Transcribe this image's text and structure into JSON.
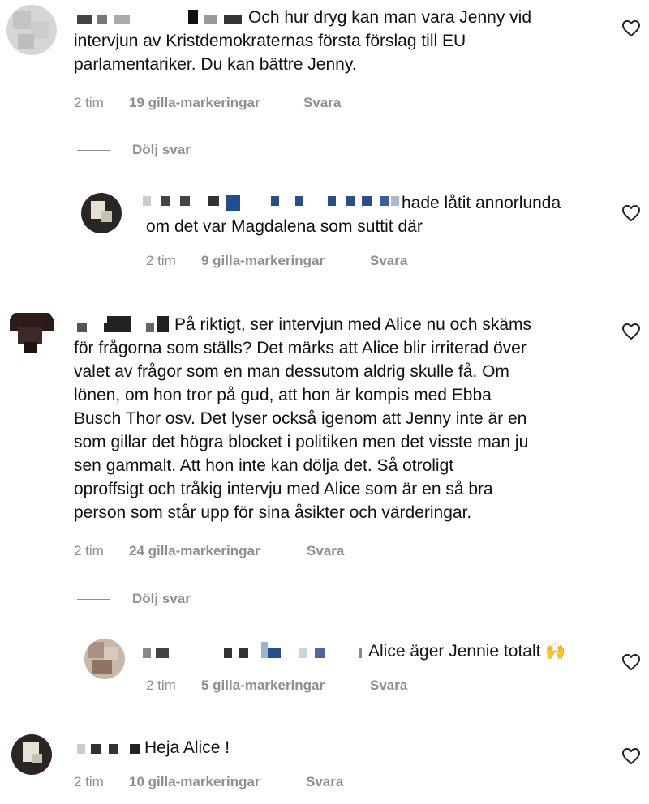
{
  "comments": [
    {
      "text": "Och hur dryg kan man vara Jenny vid intervjun av Kristdemokraternas första förslag till EU parlamentariker. Du kan bättre Jenny.",
      "line1": "Och hur dryg kan man vara Jenny vid",
      "line2": "intervjun av Kristdemokraternas första förslag till EU",
      "line3": "parlamentariker. Du kan bättre Jenny.",
      "time": "2 tim",
      "likes": "19 gilla-markeringar",
      "reply": "Svara",
      "hide_replies": "Dölj svar",
      "replies": [
        {
          "line1": "hade låtit annorlunda",
          "line2": "om det var Magdalena som suttit där",
          "time": "2 tim",
          "likes": "9 gilla-markeringar",
          "reply": "Svara"
        }
      ]
    },
    {
      "line1": "På riktigt, ser intervjun med Alice nu och skäms",
      "line2": "för frågorna som ställs? Det märks att Alice blir irriterad över",
      "line3": "valet av frågor som en man dessutom aldrig skulle få. Om",
      "line4": "lönen, om hon tror på gud, att hon är kompis med Ebba",
      "line5": "Busch Thor osv. Det lyser också igenom att Jenny inte är en",
      "line6": "som gillar det högra blocket i politiken men det visste man ju",
      "line7": "sen gammalt. Att hon inte kan dölja det. Så otroligt",
      "line8": "oproffsigt och tråkig intervju med Alice som är en så bra",
      "line9": "person som står upp för sina åsikter och värderingar.",
      "time": "2 tim",
      "likes": "24 gilla-markeringar",
      "reply": "Svara",
      "hide_replies": "Dölj svar",
      "replies": [
        {
          "line1": "Alice äger Jennie totalt",
          "emoji": "🙌",
          "time": "2 tim",
          "likes": "5 gilla-markeringar",
          "reply": "Svara"
        }
      ]
    },
    {
      "line1": "Heja Alice !",
      "time": "2 tim",
      "likes": "10 gilla-markeringar",
      "reply": "Svara"
    }
  ],
  "icons": {
    "like": "heart-outline-icon"
  }
}
